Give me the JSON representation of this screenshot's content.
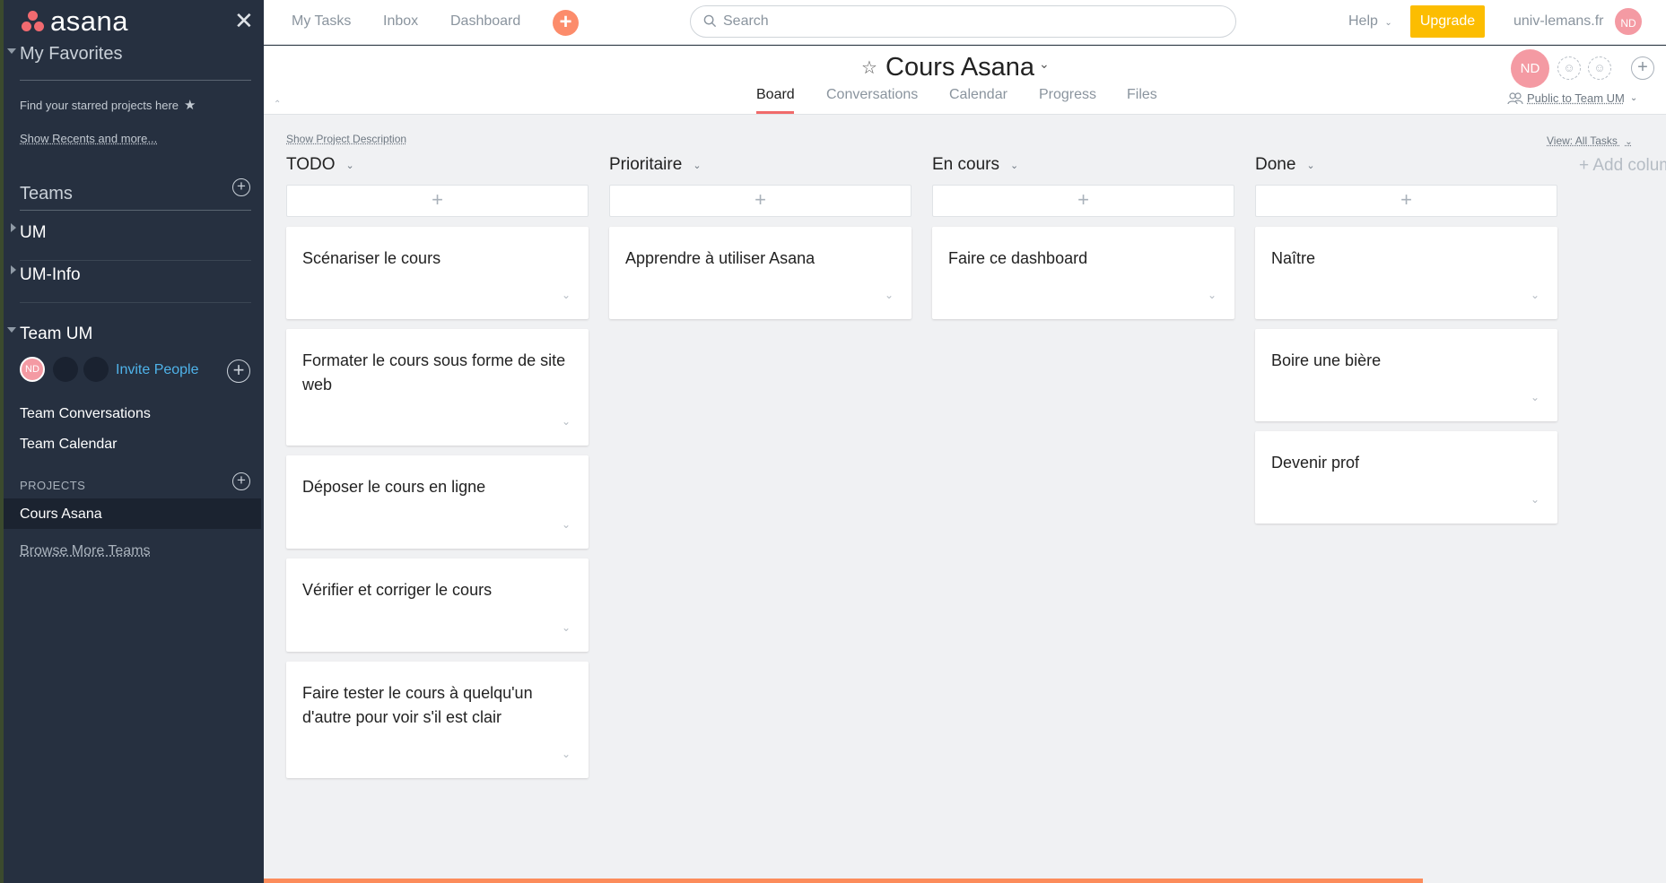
{
  "brand": {
    "logo_text": "asana",
    "accent": "#f16a70",
    "link_color": "#4fb3ea",
    "upgrade_color": "#fcbd01"
  },
  "sidebar": {
    "close": "✕",
    "favorites": {
      "title": "My Favorites",
      "hint": "Find your starred projects here",
      "recents_link": "Show Recents and more..."
    },
    "teams_title": "Teams",
    "teams": [
      "UM",
      "UM-Info"
    ],
    "current_team": {
      "name": "Team UM",
      "member_initials": "ND",
      "invite": "Invite People",
      "links": [
        "Team Conversations",
        "Team Calendar"
      ],
      "projects_title": "PROJECTS",
      "projects": [
        "Cours Asana"
      ]
    },
    "browse": "Browse More Teams"
  },
  "topbar": {
    "nav": [
      "My Tasks",
      "Inbox",
      "Dashboard"
    ],
    "quick_add": "+",
    "search_placeholder": "Search",
    "help": "Help",
    "upgrade": "Upgrade",
    "workspace": "univ-lemans.fr",
    "user_initials": "ND"
  },
  "project": {
    "title": "Cours Asana",
    "tabs": [
      "Board",
      "Conversations",
      "Calendar",
      "Progress",
      "Files"
    ],
    "active_tab": "Board",
    "owner_initials": "ND",
    "privacy": "Public to Team UM"
  },
  "board": {
    "show_description": "Show Project Description",
    "view_filter": "View: All Tasks",
    "add_column": "+ Add colum",
    "add_task_symbol": "+",
    "columns": [
      {
        "name": "TODO",
        "tasks": [
          "Scénariser le cours",
          "Formater le cours sous forme de site web",
          "Déposer le cours en ligne",
          "Vérifier et corriger le cours",
          "Faire tester le cours à quelqu'un d'autre pour voir s'il est clair"
        ]
      },
      {
        "name": "Prioritaire",
        "tasks": [
          "Apprendre à utiliser Asana"
        ]
      },
      {
        "name": "En cours",
        "tasks": [
          "Faire ce dashboard"
        ]
      },
      {
        "name": "Done",
        "tasks": [
          "Naître",
          "Boire une bière",
          "Devenir prof"
        ]
      }
    ]
  }
}
